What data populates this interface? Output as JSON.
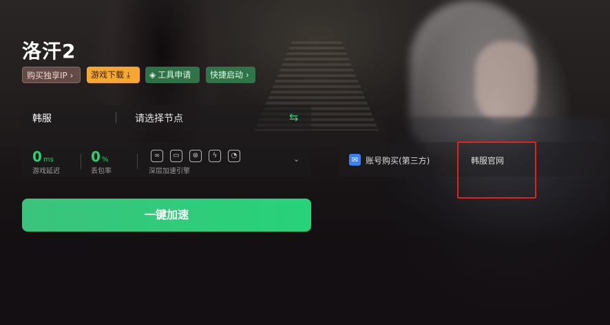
{
  "game": {
    "title": "洛汗2"
  },
  "tags": {
    "exclusive_ip": "购买独享IP",
    "download": "游戏下载",
    "tools": "工具申请",
    "quick_launch": "快捷启动"
  },
  "selector": {
    "server": "韩服",
    "node_placeholder": "请选择节点"
  },
  "stats": {
    "latency_value": "0",
    "latency_unit": "ms",
    "latency_label": "游戏延迟",
    "loss_value": "0",
    "loss_unit": "%",
    "loss_label": "丢包率",
    "engine_label": "深层加速引擎"
  },
  "boost_button": "一键加速",
  "links": {
    "buy_account": "账号购买(第三方)",
    "official_site": "韩服官网"
  },
  "colors": {
    "accent_green": "#2ccf71",
    "download_orange": "#f5a731",
    "highlight_red": "#e3221e"
  }
}
